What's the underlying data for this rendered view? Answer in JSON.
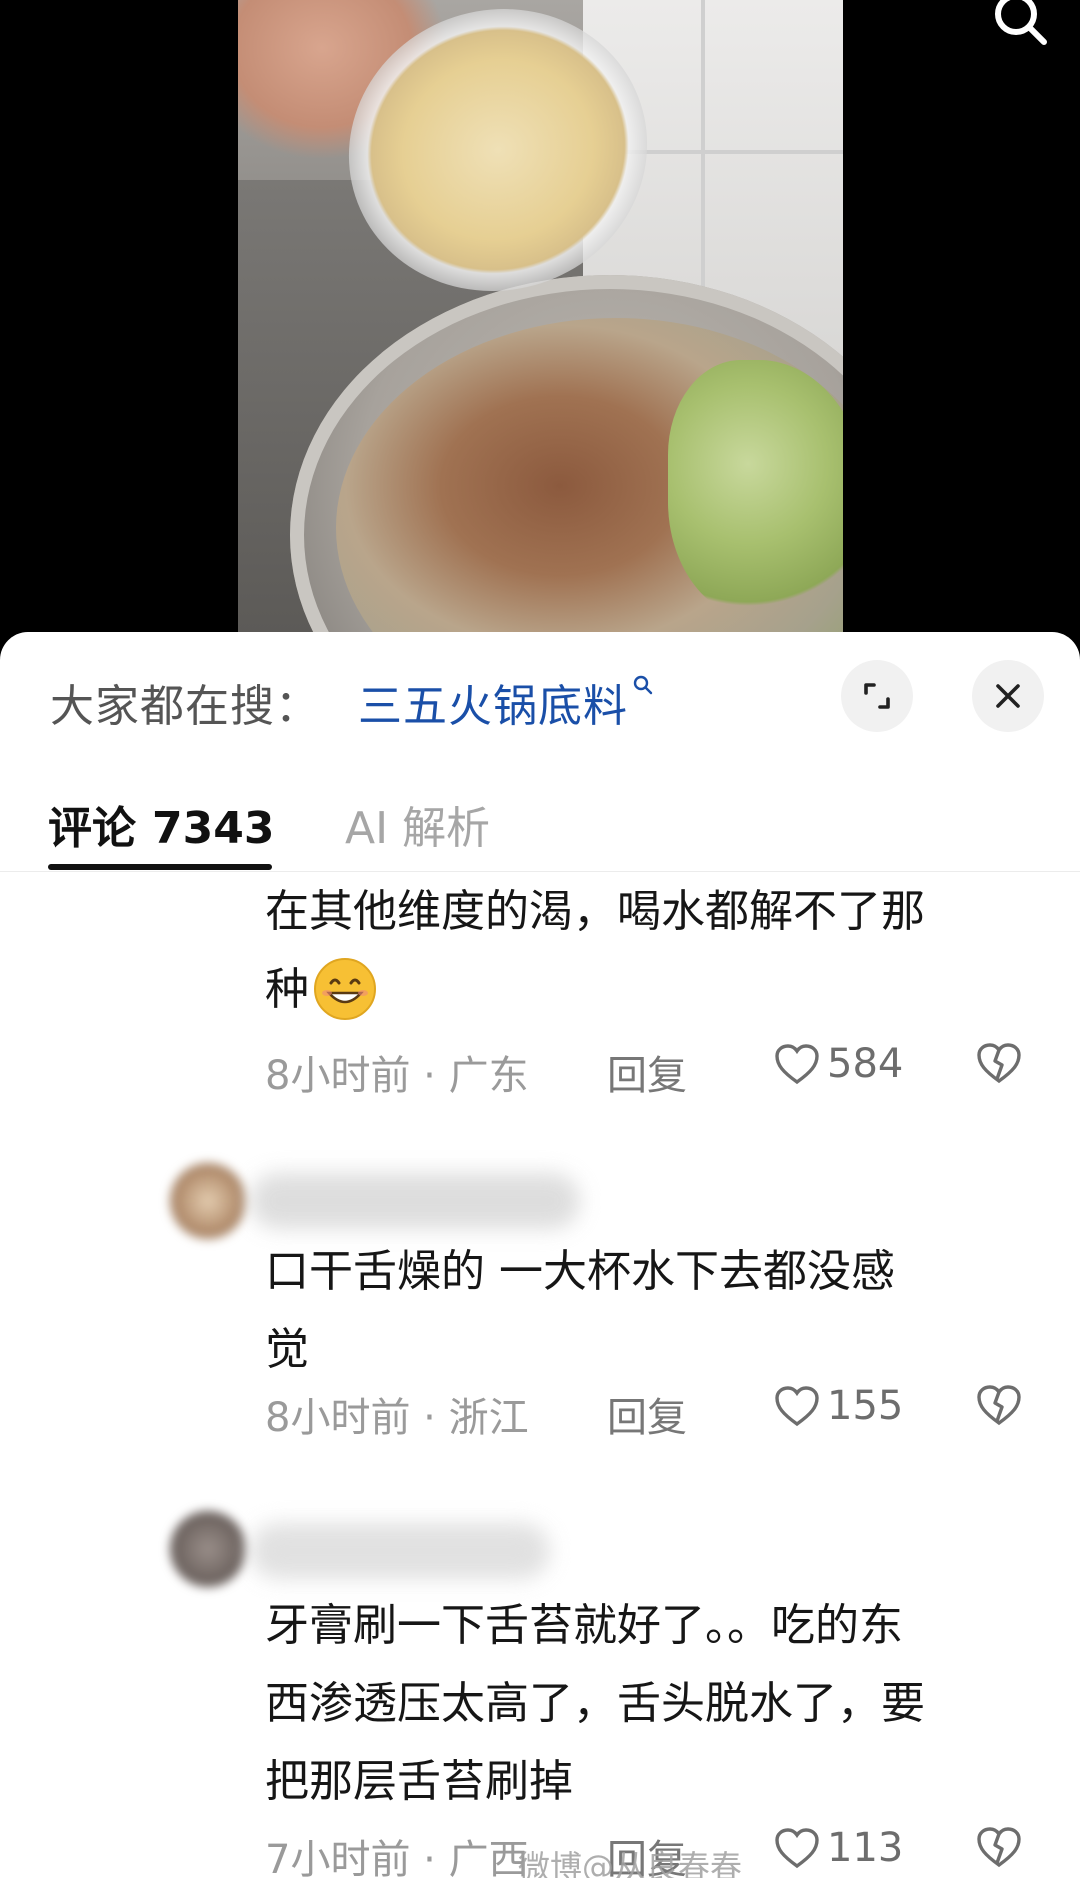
{
  "video": {
    "description_icon": "search-icon"
  },
  "search_bar": {
    "prefix": "大家都在搜：",
    "term": "三五火锅底料",
    "term_icon": "search-icon",
    "expand_icon": "expand-icon",
    "close_icon": "close-icon"
  },
  "tabs": {
    "comments_label": "评论",
    "comments_count": "7343",
    "ai_label": "AI 解析"
  },
  "comments": [
    {
      "text_line1": "在其他维度的渴，喝水都解不了那",
      "text_line2": "种",
      "emoji": "grinning-face-emoji",
      "time_location": "8小时前 · 广东",
      "reply_label": "回复",
      "likes": "584"
    },
    {
      "text_line1": "口干舌燥的 一大杯水下去都没感",
      "text_line2": "觉",
      "time_location": "8小时前 · 浙江",
      "reply_label": "回复",
      "likes": "155"
    },
    {
      "text_line1": "牙膏刷一下舌苔就好了。。吃的东",
      "text_line2": "西渗透压太高了，舌头脱水了，要",
      "text_line3": "把那层舌苔刷掉",
      "time_location": "7小时前 · 广西",
      "reply_label": "回复",
      "likes": "113"
    }
  ],
  "watermark": "微博@从良春春",
  "colors": {
    "link_blue": "#1a4fa8",
    "muted_gray": "#9a9a9a",
    "tab_inactive": "#a6a6a6"
  }
}
